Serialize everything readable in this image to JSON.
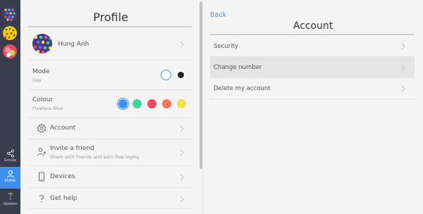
{
  "nav": {
    "items": [
      {
        "label": "Groups"
      },
      {
        "label": "Profile"
      },
      {
        "label": "Updates"
      }
    ]
  },
  "profile": {
    "title": "Profile",
    "user_name": "Hung Anh",
    "mode": {
      "label": "Mode",
      "value": "Day"
    },
    "colour": {
      "label": "Colour",
      "value": "Flawless Blue",
      "options": [
        "#3f8ff0",
        "#3fd39a",
        "#f24b5c",
        "#ff7454",
        "#f2e34a"
      ]
    },
    "menu": [
      {
        "label": "Account",
        "sub": ""
      },
      {
        "label": "Invite a friend",
        "sub": "Share with friends and earn free logins"
      },
      {
        "label": "Devices",
        "sub": ""
      },
      {
        "label": "Get help",
        "sub": ""
      }
    ]
  },
  "account": {
    "back_label": "Back",
    "title": "Account",
    "items": [
      {
        "label": "Security"
      },
      {
        "label": "Change number"
      },
      {
        "label": "Delete my account"
      }
    ]
  }
}
